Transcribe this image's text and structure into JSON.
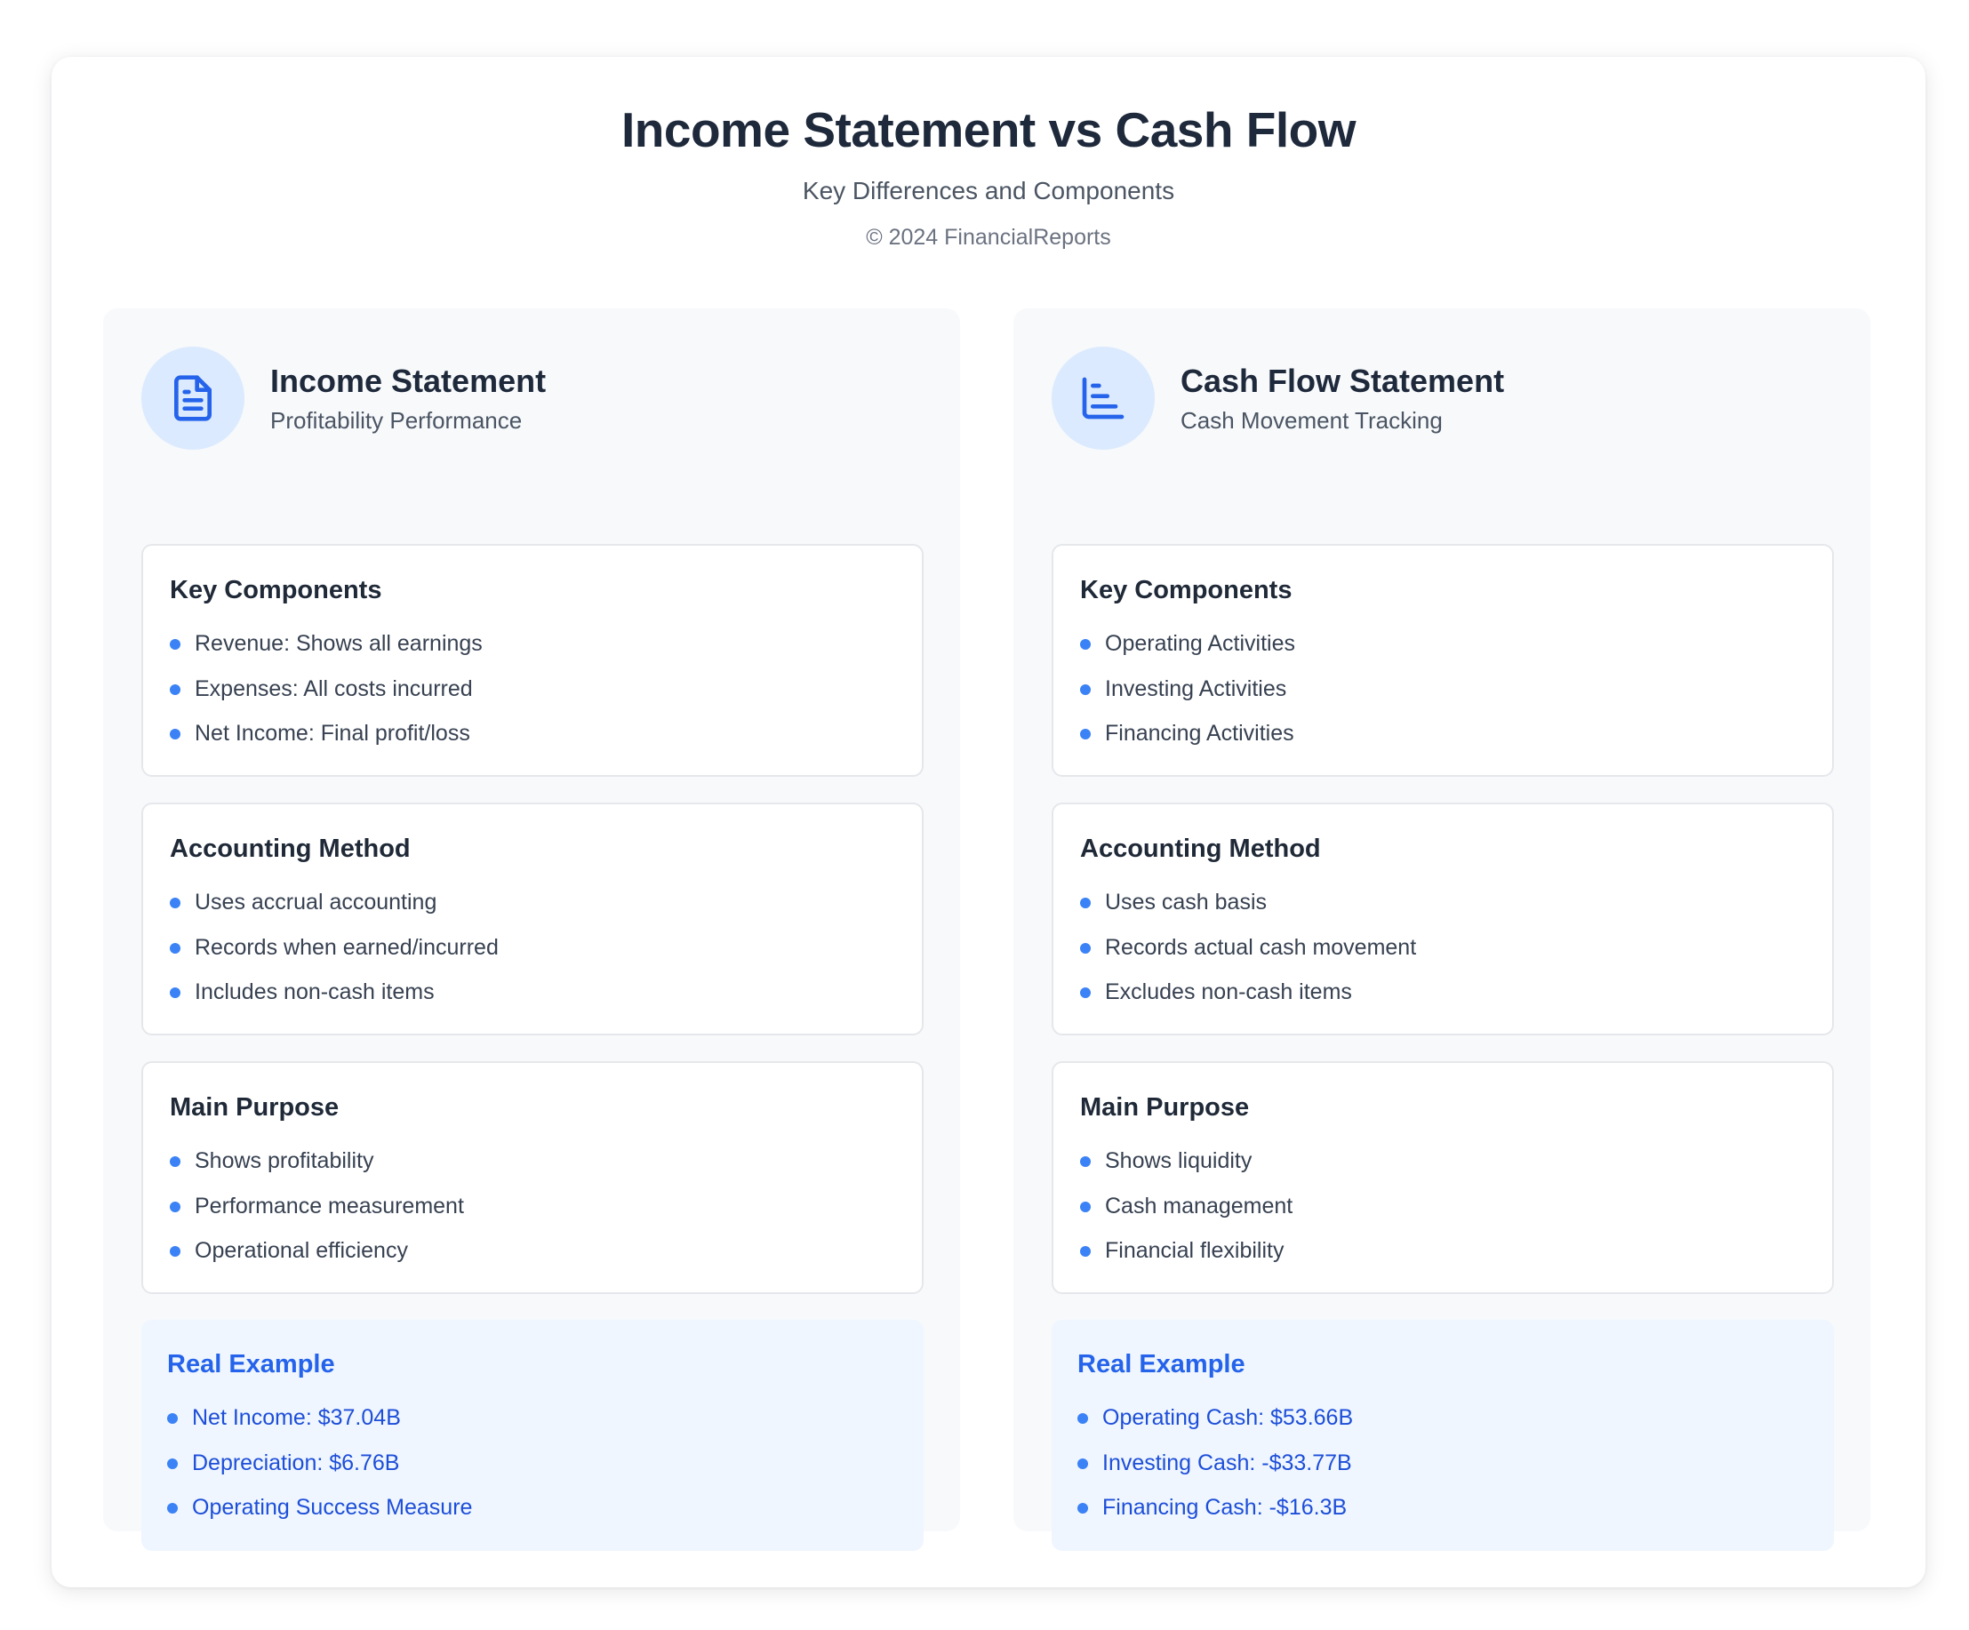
{
  "header": {
    "title": "Income Statement vs Cash Flow",
    "subtitle": "Key Differences and Components",
    "copyright": "© 2024 FinancialReports"
  },
  "colors": {
    "accent": "#3b82f6",
    "accent_dark": "#2563eb",
    "icon_bg": "#dbeafe",
    "example_bg": "#eff6ff"
  },
  "columns": [
    {
      "icon": "document-icon",
      "title": "Income Statement",
      "subtitle": "Profitability Performance",
      "sections": [
        {
          "title": "Key Components",
          "items": [
            "Revenue: Shows all earnings",
            "Expenses: All costs incurred",
            "Net Income: Final profit/loss"
          ]
        },
        {
          "title": "Accounting Method",
          "items": [
            "Uses accrual accounting",
            "Records when earned/incurred",
            "Includes non-cash items"
          ]
        },
        {
          "title": "Main Purpose",
          "items": [
            "Shows profitability",
            "Performance measurement",
            "Operational efficiency"
          ]
        }
      ],
      "example": {
        "title": "Real Example",
        "items": [
          "Net Income: $37.04B",
          "Depreciation: $6.76B",
          "Operating Success Measure"
        ]
      }
    },
    {
      "icon": "bar-chart-icon",
      "title": "Cash Flow Statement",
      "subtitle": "Cash Movement Tracking",
      "sections": [
        {
          "title": "Key Components",
          "items": [
            "Operating Activities",
            "Investing Activities",
            "Financing Activities"
          ]
        },
        {
          "title": "Accounting Method",
          "items": [
            "Uses cash basis",
            "Records actual cash movement",
            "Excludes non-cash items"
          ]
        },
        {
          "title": "Main Purpose",
          "items": [
            "Shows liquidity",
            "Cash management",
            "Financial flexibility"
          ]
        }
      ],
      "example": {
        "title": "Real Example",
        "items": [
          "Operating Cash: $53.66B",
          "Investing Cash: -$33.77B",
          "Financing Cash: -$16.3B"
        ]
      }
    }
  ]
}
